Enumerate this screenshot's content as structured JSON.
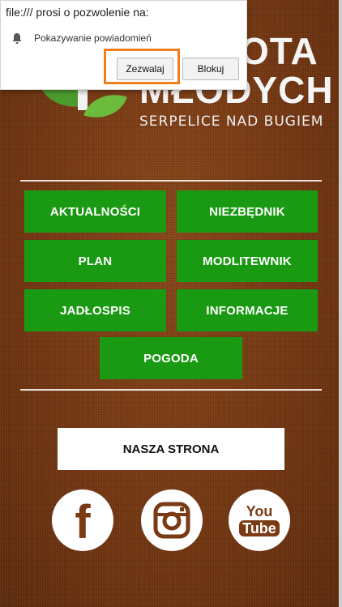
{
  "popup": {
    "title": "file:/// prosi o pozwolenie na:",
    "permission": "Pokazywanie powiadomień",
    "allow_label": "Zezwalaj",
    "block_label": "Blokuj"
  },
  "logo": {
    "line1": "OTA",
    "line2": "MŁODYCH",
    "subtitle": "SERPELICE NAD BUGIEM"
  },
  "menu": [
    {
      "label": "AKTUALNOŚCI"
    },
    {
      "label": "NIEZBĘDNIK"
    },
    {
      "label": "PLAN"
    },
    {
      "label": "MODLITEWNIK"
    },
    {
      "label": "JADŁOSPIS"
    },
    {
      "label": "INFORMACJE"
    },
    {
      "label": "POGODA"
    }
  ],
  "site_button": {
    "label": "NASZA STRONA"
  },
  "social": [
    {
      "icon": "facebook-icon",
      "text": "f"
    },
    {
      "icon": "instagram-icon",
      "text": ""
    },
    {
      "icon": "youtube-icon",
      "text_top": "You",
      "text_bottom": "Tube"
    }
  ],
  "colors": {
    "menu_green": "#1a9a13",
    "highlight_orange": "#f07e1d",
    "background_brown": "#7a3a14"
  }
}
